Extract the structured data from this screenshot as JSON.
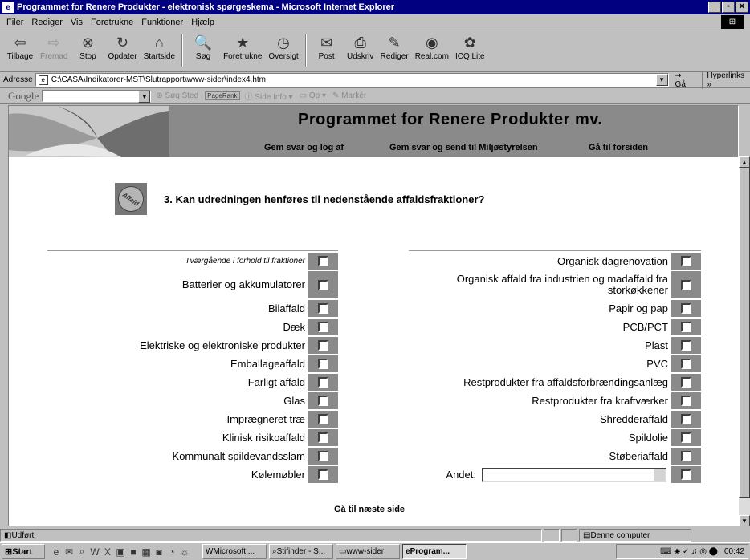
{
  "window": {
    "title": "Programmet for Renere Produkter - elektronisk spørgeskema - Microsoft Internet Explorer"
  },
  "menu": [
    "Filer",
    "Rediger",
    "Vis",
    "Foretrukne",
    "Funktioner",
    "Hjælp"
  ],
  "toolbar": [
    {
      "label": "Tilbage",
      "icon": "back-icon",
      "glyph": "⇦",
      "enabled": true
    },
    {
      "label": "Fremad",
      "icon": "forward-icon",
      "glyph": "⇨",
      "enabled": false
    },
    {
      "label": "Stop",
      "icon": "stop-icon",
      "glyph": "⊗",
      "enabled": true
    },
    {
      "label": "Opdater",
      "icon": "refresh-icon",
      "glyph": "↻",
      "enabled": true
    },
    {
      "label": "Startside",
      "icon": "home-icon",
      "glyph": "⌂",
      "enabled": true
    },
    {
      "label": "Søg",
      "icon": "search-icon",
      "glyph": "🔍",
      "enabled": true
    },
    {
      "label": "Foretrukne",
      "icon": "favorites-icon",
      "glyph": "★",
      "enabled": true
    },
    {
      "label": "Oversigt",
      "icon": "history-icon",
      "glyph": "◷",
      "enabled": true
    },
    {
      "label": "Post",
      "icon": "mail-icon",
      "glyph": "✉",
      "enabled": true
    },
    {
      "label": "Udskriv",
      "icon": "print-icon",
      "glyph": "⎙",
      "enabled": true
    },
    {
      "label": "Rediger",
      "icon": "edit-icon",
      "glyph": "✎",
      "enabled": true
    },
    {
      "label": "Real.com",
      "icon": "realcom-icon",
      "glyph": "◉",
      "enabled": true
    },
    {
      "label": "ICQ Lite",
      "icon": "icq-icon",
      "glyph": "✿",
      "enabled": true
    }
  ],
  "address": {
    "label": "Adresse",
    "value": "C:\\CASA\\Indikatorer-MST\\Slutrapport\\www-sider\\index4.htm",
    "go": "Gå",
    "links": "Hyperlinks »"
  },
  "google": {
    "logo": "Google",
    "search_label": "Søg Sted",
    "pagerank": "PageRank",
    "info": "Side Info",
    "up": "Op",
    "highlight": "Markér"
  },
  "page": {
    "title": "Programmet for Renere Produkter mv.",
    "nav": [
      "Gem svar og log af",
      "Gem svar og send til Miljøstyrelsen",
      "Gå til forsiden"
    ],
    "question": "3. Kan udredningen henføres til nedenstående affaldsfraktioner?",
    "icon_text": "Affald",
    "left_items": [
      "Tværgående i forhold til fraktioner",
      "Batterier og akkumulatorer",
      "Bilaffald",
      "Dæk",
      "Elektriske og elektroniske produkter",
      "Emballageaffald",
      "Farligt affald",
      "Glas",
      "Imprægneret træ",
      "Klinisk risikoaffald",
      "Kommunalt spildevandsslam",
      "Kølemøbler"
    ],
    "right_items": [
      "Organisk dagrenovation",
      "Organisk affald fra industrien og madaffald fra storkøkkener",
      "Papir og pap",
      "PCB/PCT",
      "Plast",
      "PVC",
      "Restprodukter fra affaldsforbrændingsanlæg",
      "Restprodukter fra kraftværker",
      "Shredderaffald",
      "Spildolie",
      "Støberiaffald"
    ],
    "other_label": "Andet:",
    "other_value": "",
    "next": "Gå til næste side"
  },
  "status": {
    "text": "Udført",
    "zone": "Denne computer"
  },
  "taskbar": {
    "start": "Start",
    "tasks": [
      "Microsoft ...",
      "Stifinder - S...",
      "www-sider",
      "Program..."
    ],
    "clock": "00:42"
  }
}
